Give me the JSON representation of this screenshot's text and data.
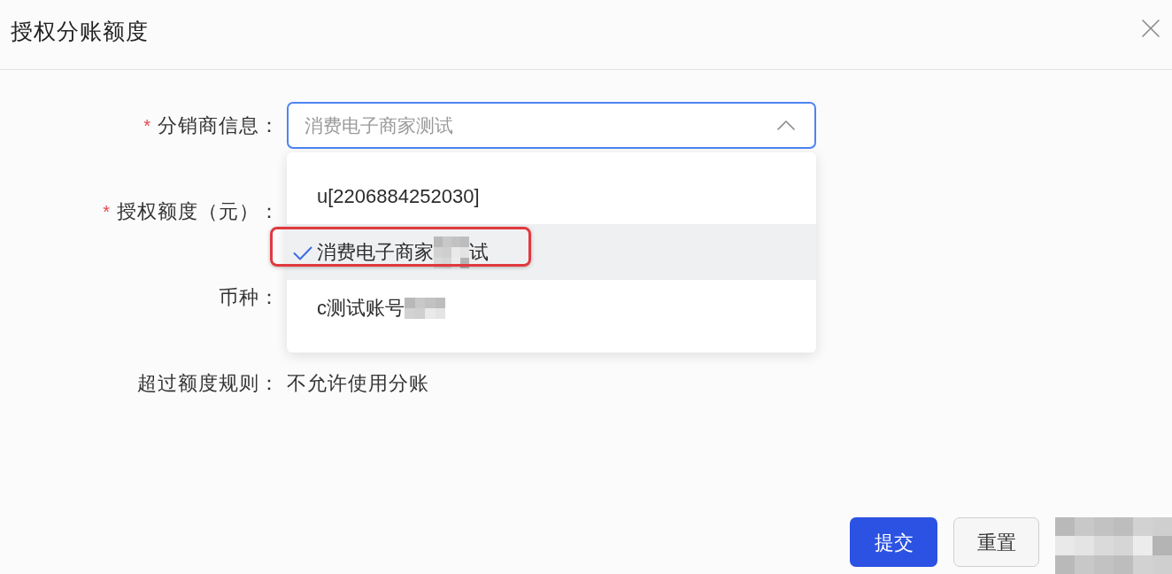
{
  "dialog": {
    "title": "授权分账额度"
  },
  "form": {
    "fields": [
      {
        "kind": "select",
        "label": "分销商信息：",
        "required_mark": "*",
        "value": "消费电子商家测试",
        "expanded": true,
        "options": [
          {
            "label": "u[2206884252030]",
            "selected": false,
            "redacted": false,
            "highlighted": false
          },
          {
            "label": "消费电子商家",
            "label_tail": "试",
            "selected": true,
            "redacted": true,
            "highlighted": true
          },
          {
            "label": "c测试账号",
            "selected": false,
            "redacted": true,
            "highlighted": false
          }
        ]
      },
      {
        "kind": "label_only",
        "label": "授权额度（元）：",
        "required_mark": "*"
      },
      {
        "kind": "label_only",
        "label": "币种："
      },
      {
        "kind": "text",
        "label": "超过额度规则：",
        "value": "不允许使用分账"
      }
    ]
  },
  "buttons": [
    {
      "kind": "primary",
      "label": "提交"
    },
    {
      "kind": "default",
      "label": "重置"
    },
    {
      "kind": "redacted"
    }
  ]
}
